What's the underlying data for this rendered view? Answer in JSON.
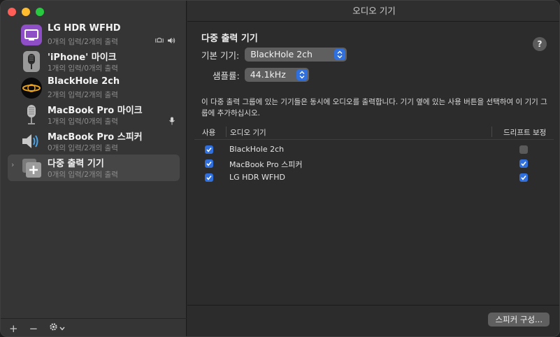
{
  "window": {
    "title": "오디오 기기"
  },
  "sidebar": {
    "devices": [
      {
        "name": "LG HDR WFHD",
        "sub": "0개의 입력/2개의 출력",
        "icon": "monitor-icon",
        "indicators": "alert-speaker"
      },
      {
        "name": "'iPhone' 마이크",
        "sub": "1개의 입력/0개의 출력",
        "icon": "microphone-icon"
      },
      {
        "name": "BlackHole 2ch",
        "sub": "2개의 입력/2개의 출력",
        "icon": "blackhole-icon"
      },
      {
        "name": "MacBook Pro 마이크",
        "sub": "1개의 입력/0개의 출력",
        "icon": "microphone-icon",
        "indicators": "mic"
      },
      {
        "name": "MacBook Pro 스피커",
        "sub": "0개의 입력/2개의 출력",
        "icon": "speaker-icon"
      },
      {
        "name": "다중 출력 기기",
        "sub": "0개의 입력/2개의 출력",
        "icon": "multi-output-icon",
        "selected": true
      }
    ],
    "footer": {
      "add": "+",
      "remove": "−"
    }
  },
  "main": {
    "title": "다중 출력 기기",
    "help": "?",
    "primary_label": "기본 기기:",
    "primary_value": "BlackHole 2ch",
    "samplerate_label": "샘플률:",
    "samplerate_value": "44.1kHz",
    "description": "이 다중 출력 그룹에 있는 기기들은 동시에 오디오를 출력합니다. 기기 옆에 있는 사용 버튼을 선택하여 이 기기 그룹에 추가하십시오.",
    "table": {
      "col_use": "사용",
      "col_device": "오디오 기기",
      "col_drift": "드리프트 보정",
      "rows": [
        {
          "device": "BlackHole 2ch",
          "use": true,
          "drift": false
        },
        {
          "device": "MacBook Pro 스피커",
          "use": true,
          "drift": true
        },
        {
          "device": "LG HDR WFHD",
          "use": true,
          "drift": true
        }
      ]
    },
    "speaker_button": "스피커 구성..."
  },
  "colors": {
    "accent": "#2f6fde",
    "background": "#2c2c2c",
    "sidebar": "#353535"
  }
}
